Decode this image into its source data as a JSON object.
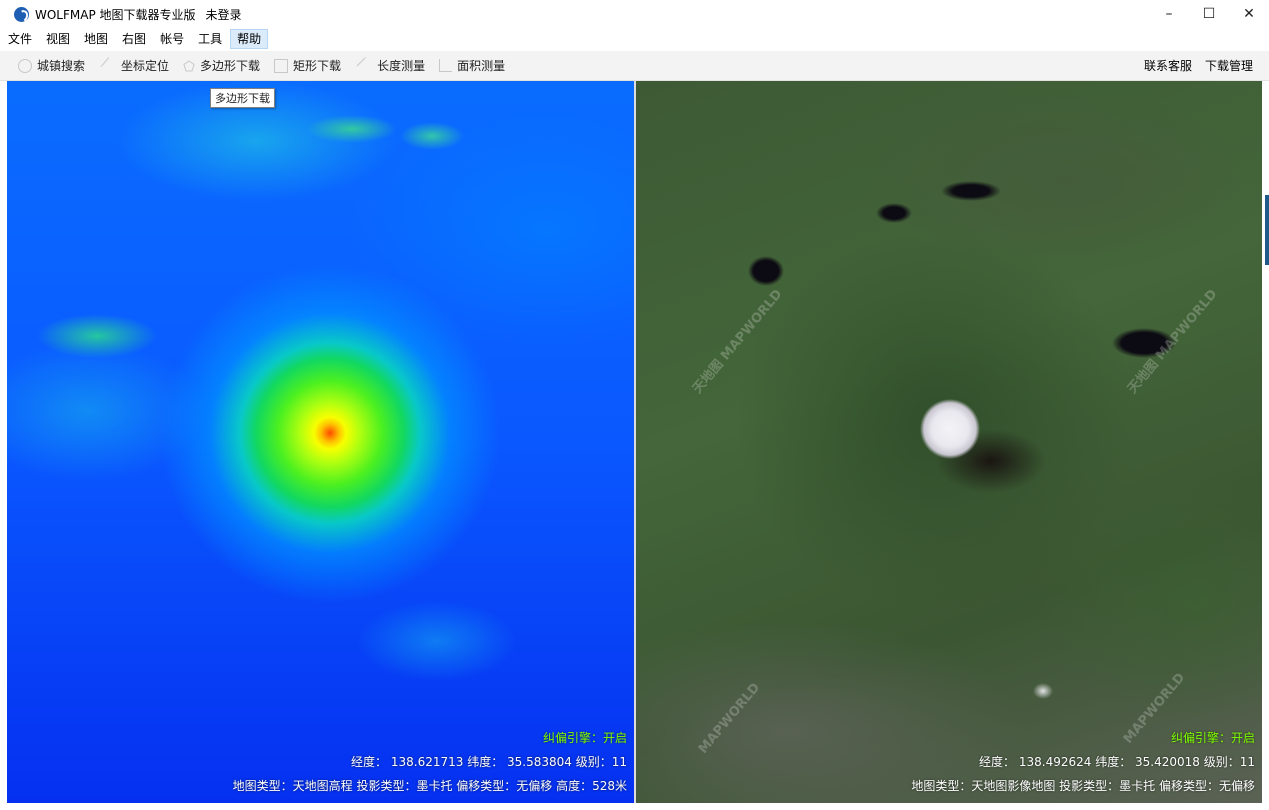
{
  "window": {
    "title": "WOLFMAP 地图下载器专业版",
    "login_status": "未登录",
    "controls": {
      "minimize": "–",
      "maximize": "☐",
      "close": "✕"
    }
  },
  "menu": [
    {
      "label": "文件"
    },
    {
      "label": "视图"
    },
    {
      "label": "地图"
    },
    {
      "label": "右图"
    },
    {
      "label": "帐号"
    },
    {
      "label": "工具"
    },
    {
      "label": "帮助",
      "active": true
    }
  ],
  "toolbar": {
    "items": [
      {
        "label": "城镇搜索",
        "icon": "search-icon"
      },
      {
        "label": "坐标定位",
        "icon": "pin-icon"
      },
      {
        "label": "多边形下载",
        "icon": "polygon-icon"
      },
      {
        "label": "矩形下载",
        "icon": "rectangle-icon"
      },
      {
        "label": "长度测量",
        "icon": "ruler-icon"
      },
      {
        "label": "面积测量",
        "icon": "area-icon"
      }
    ],
    "right": {
      "contact": "联系客服",
      "download_manager": "下载管理"
    }
  },
  "tooltip": "多边形下载",
  "left_map": {
    "engine": "纠偏引擎：开启",
    "coords": "经度：  138.621713 纬度：   35.583804 级别：11",
    "info": "地图类型：天地图高程   投影类型：墨卡托   偏移类型：无偏移   高度：528米"
  },
  "right_map": {
    "engine": "纠偏引擎：开启",
    "coords": "经度：  138.492624 纬度：   35.420018 级别：11",
    "info": "地图类型：天地图影像地图   投影类型：墨卡托   偏移类型：无偏移"
  },
  "colors": {
    "menu_active_bg": "#dcebf9",
    "engine_text": "#7fff00",
    "elevation_low": "#0530f0",
    "elevation_peak": "#ff4a00"
  }
}
